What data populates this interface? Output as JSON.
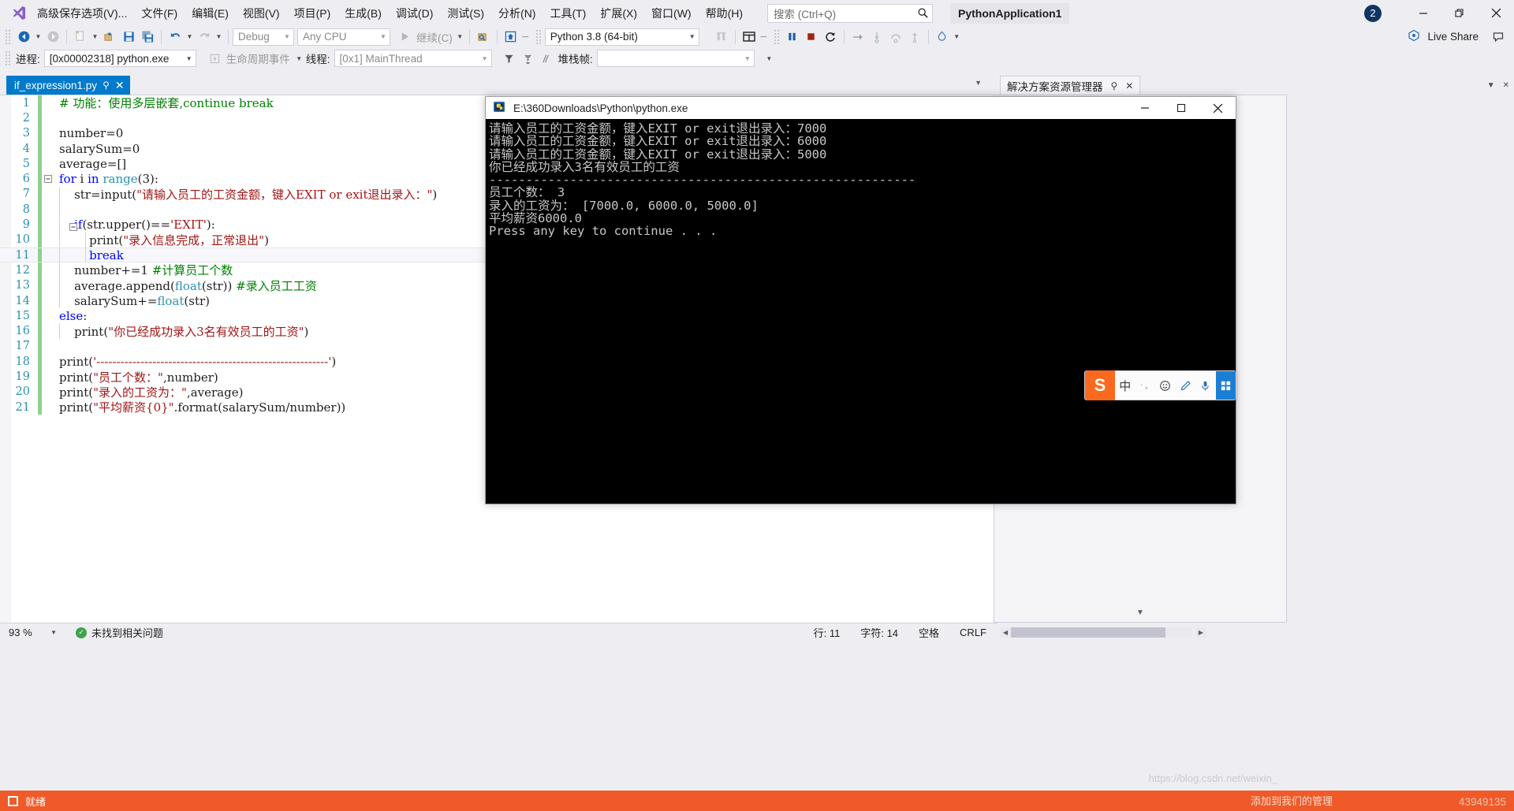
{
  "window": {
    "title": "PythonApplication1",
    "notification_count": "2",
    "minimize": "—",
    "restore": "❐",
    "close": "✕"
  },
  "menu": {
    "logo_icon": "visual-studio-logo",
    "items": [
      "高级保存选项(V)...",
      "文件(F)",
      "编辑(E)",
      "视图(V)",
      "项目(P)",
      "生成(B)",
      "调试(D)",
      "测试(S)",
      "分析(N)",
      "工具(T)",
      "扩展(X)",
      "窗口(W)",
      "帮助(H)"
    ],
    "search_placeholder": "搜索 (Ctrl+Q)",
    "search_icon": "search-icon"
  },
  "live_share": {
    "label": "Live Share",
    "icon": "live-share-icon",
    "feedback_icon": "feedback-icon"
  },
  "toolbar": {
    "nav_back_icon": "navigate-back-icon",
    "nav_forward_icon": "navigate-forward-icon",
    "new_item_icon": "new-item-icon",
    "open_icon": "open-file-icon",
    "save_icon": "save-icon",
    "save_all_icon": "save-all-icon",
    "undo_icon": "undo-icon",
    "redo_icon": "redo-icon",
    "config_value": "Debug",
    "platform_value": "Any CPU",
    "start_label": "继续(C)",
    "start_icon": "play-icon",
    "attach_icon": "attach-process-icon",
    "home_icon": "home-icon",
    "interpreter_value": "Python 3.8 (64-bit)",
    "step_icon": "step-icon",
    "layout_icon": "window-layout-icon",
    "pause_icon": "pause-icon",
    "stop_icon": "stop-icon",
    "restart_icon": "restart-icon",
    "step_into_icon": "step-into-icon",
    "step_over_icon": "step-over-icon",
    "step_out_icon": "step-out-icon",
    "hot_reload_icon": "hot-reload-icon",
    "arrow_icon": "arrow-right-icon"
  },
  "debugbar": {
    "process_label": "进程:",
    "process_value": "[0x00002318] python.exe",
    "lifecycle_icon": "lifecycle-events-icon",
    "lifecycle_label": "生命周期事件",
    "thread_label": "线程:",
    "thread_value": "[0x1] MainThread",
    "filter_icon": "filter-icon",
    "filter2_icon": "filter-down-icon",
    "flag_icon": "flag-icon",
    "stackframe_label": "堆栈帧:",
    "stackframe_value": ""
  },
  "tabs": {
    "active": {
      "label": "if_expression1.py",
      "pin_icon": "pin-icon",
      "close_icon": "close-icon"
    },
    "overflow_icon": "chevron-down-icon"
  },
  "solution_explorer": {
    "title": "解决方案资源管理器",
    "pin_icon": "pin-icon",
    "close_icon": "close-icon",
    "collapse_icon": "chevron-down-icon",
    "maximize_icon": "chevron-up-icon",
    "panel_close_icon": "close-icon"
  },
  "editor": {
    "lines": [
      {
        "n": "1",
        "changed": true,
        "fold": "",
        "indent": 0,
        "current": false,
        "tokens": [
          {
            "t": "# 功能：使用多层嵌套,continue break",
            "c": "cmt"
          }
        ]
      },
      {
        "n": "2",
        "changed": true,
        "fold": "",
        "indent": 0,
        "current": false,
        "tokens": []
      },
      {
        "n": "3",
        "changed": true,
        "fold": "",
        "indent": 0,
        "current": false,
        "tokens": [
          {
            "t": "number=0",
            "c": "pl"
          }
        ]
      },
      {
        "n": "4",
        "changed": true,
        "fold": "",
        "indent": 0,
        "current": false,
        "tokens": [
          {
            "t": "salarySum=0",
            "c": "pl"
          }
        ]
      },
      {
        "n": "5",
        "changed": true,
        "fold": "",
        "indent": 0,
        "current": false,
        "tokens": [
          {
            "t": "average=[]",
            "c": "pl"
          }
        ]
      },
      {
        "n": "6",
        "changed": true,
        "fold": "minus",
        "indent": 0,
        "current": false,
        "tokens": [
          {
            "t": "for",
            "c": "kw"
          },
          {
            "t": " i ",
            "c": "pl"
          },
          {
            "t": "in",
            "c": "kw"
          },
          {
            "t": " ",
            "c": "pl"
          },
          {
            "t": "range",
            "c": "kw2"
          },
          {
            "t": "(3):",
            "c": "pl"
          }
        ]
      },
      {
        "n": "7",
        "changed": true,
        "fold": "",
        "indent": 1,
        "current": false,
        "tokens": [
          {
            "t": "    str=input(",
            "c": "pl"
          },
          {
            "t": "\"请输入员工的工资金额，键入EXIT or exit退出录入：\"",
            "c": "str"
          },
          {
            "t": ")",
            "c": "pl"
          }
        ]
      },
      {
        "n": "8",
        "changed": true,
        "fold": "",
        "indent": 1,
        "current": false,
        "tokens": []
      },
      {
        "n": "9",
        "changed": true,
        "fold": "minus2",
        "indent": 1,
        "current": false,
        "tokens": [
          {
            "t": "    ",
            "c": "pl"
          },
          {
            "t": "if",
            "c": "kw"
          },
          {
            "t": "(str.upper()==",
            "c": "pl"
          },
          {
            "t": "'EXIT'",
            "c": "str"
          },
          {
            "t": "):",
            "c": "pl"
          }
        ]
      },
      {
        "n": "10",
        "changed": true,
        "fold": "",
        "indent": 2,
        "current": false,
        "tokens": [
          {
            "t": "        print(",
            "c": "pl"
          },
          {
            "t": "\"录入信息完成，正常退出\"",
            "c": "str"
          },
          {
            "t": ")",
            "c": "pl"
          }
        ]
      },
      {
        "n": "11",
        "changed": true,
        "fold": "",
        "indent": 2,
        "current": true,
        "tokens": [
          {
            "t": "        ",
            "c": "pl"
          },
          {
            "t": "break",
            "c": "kw"
          }
        ]
      },
      {
        "n": "12",
        "changed": true,
        "fold": "",
        "indent": 1,
        "current": false,
        "tokens": [
          {
            "t": "    number+=1 ",
            "c": "pl"
          },
          {
            "t": "#计算员工个数",
            "c": "cmt"
          }
        ]
      },
      {
        "n": "13",
        "changed": true,
        "fold": "",
        "indent": 1,
        "current": false,
        "tokens": [
          {
            "t": "    average.append(",
            "c": "pl"
          },
          {
            "t": "float",
            "c": "kw2"
          },
          {
            "t": "(str)) ",
            "c": "pl"
          },
          {
            "t": "#录入员工工资",
            "c": "cmt"
          }
        ]
      },
      {
        "n": "14",
        "changed": true,
        "fold": "",
        "indent": 1,
        "current": false,
        "tokens": [
          {
            "t": "    salarySum+=",
            "c": "pl"
          },
          {
            "t": "float",
            "c": "kw2"
          },
          {
            "t": "(str)",
            "c": "pl"
          }
        ]
      },
      {
        "n": "15",
        "changed": true,
        "fold": "",
        "indent": 0,
        "current": false,
        "tokens": [
          {
            "t": "else",
            "c": "kw"
          },
          {
            "t": ":",
            "c": "pl"
          }
        ]
      },
      {
        "n": "16",
        "changed": true,
        "fold": "",
        "indent": 1,
        "current": false,
        "tokens": [
          {
            "t": "    print(",
            "c": "pl"
          },
          {
            "t": "\"你已经成功录入3名有效员工的工资\"",
            "c": "str"
          },
          {
            "t": ")",
            "c": "pl"
          }
        ]
      },
      {
        "n": "17",
        "changed": true,
        "fold": "",
        "indent": 0,
        "current": false,
        "tokens": []
      },
      {
        "n": "18",
        "changed": true,
        "fold": "",
        "indent": 0,
        "current": false,
        "tokens": [
          {
            "t": "print(",
            "c": "pl"
          },
          {
            "t": "'----------------------------------------------------------'",
            "c": "str"
          },
          {
            "t": ")",
            "c": "pl"
          }
        ]
      },
      {
        "n": "19",
        "changed": true,
        "fold": "",
        "indent": 0,
        "current": false,
        "tokens": [
          {
            "t": "print(",
            "c": "pl"
          },
          {
            "t": "\"员工个数：\"",
            "c": "str"
          },
          {
            "t": ",number)",
            "c": "pl"
          }
        ]
      },
      {
        "n": "20",
        "changed": true,
        "fold": "",
        "indent": 0,
        "current": false,
        "tokens": [
          {
            "t": "print(",
            "c": "pl"
          },
          {
            "t": "\"录入的工资为：\"",
            "c": "str"
          },
          {
            "t": ",average)",
            "c": "pl"
          }
        ]
      },
      {
        "n": "21",
        "changed": true,
        "fold": "",
        "indent": 0,
        "current": false,
        "tokens": [
          {
            "t": "print(",
            "c": "pl"
          },
          {
            "t": "\"平均薪资{0}\"",
            "c": "str"
          },
          {
            "t": ".format(salarySum/number))",
            "c": "pl"
          }
        ]
      }
    ]
  },
  "console": {
    "icon": "python-exe-icon",
    "title": "E:\\360Downloads\\Python\\python.exe",
    "minimize": "—",
    "maximize": "❐",
    "close": "✕",
    "output": "请输入员工的工资金额，键入EXIT or exit退出录入：7000\n请输入员工的工资金额，键入EXIT or exit退出录入：6000\n请输入员工的工资金额，键入EXIT or exit退出录入：5000\n你已经成功录入3名有效员工的工资\n----------------------------------------------------------\n员工个数： 3\n录入的工资为： [7000.0, 6000.0, 5000.0]\n平均薪资6000.0\nPress any key to continue . . ."
  },
  "ime": {
    "logo_text": "S",
    "mode": "中",
    "punct_icon": "punctuation-icon",
    "emoji_icon": "emoji-icon",
    "pen_icon": "handwriting-icon",
    "mic_icon": "microphone-icon",
    "apps_icon": "toolbox-icon"
  },
  "status": {
    "zoom": "93 %",
    "zoom_caret": "▾",
    "problems": "未找到相关问题",
    "problems_icon": "check-circle-icon",
    "line": "行: 11",
    "col": "字符: 14",
    "insert_mode": "空格",
    "eol": "CRLF",
    "ready": "就绪",
    "stop_icon": "stop-debug-icon",
    "watermark": "添加到我们的管理",
    "watermark_right": "43949135",
    "blog_watermark": "https://blog.csdn.net/weixin_"
  },
  "colors": {
    "accent": "#007acc",
    "chrome": "#eeeef2",
    "taskbar": "#f05a28",
    "keyword": "#0000ff",
    "string": "#a31515",
    "comment": "#008000",
    "type": "#2b91af",
    "linenum": "#2b91af",
    "changebar": "#8fd18f"
  }
}
